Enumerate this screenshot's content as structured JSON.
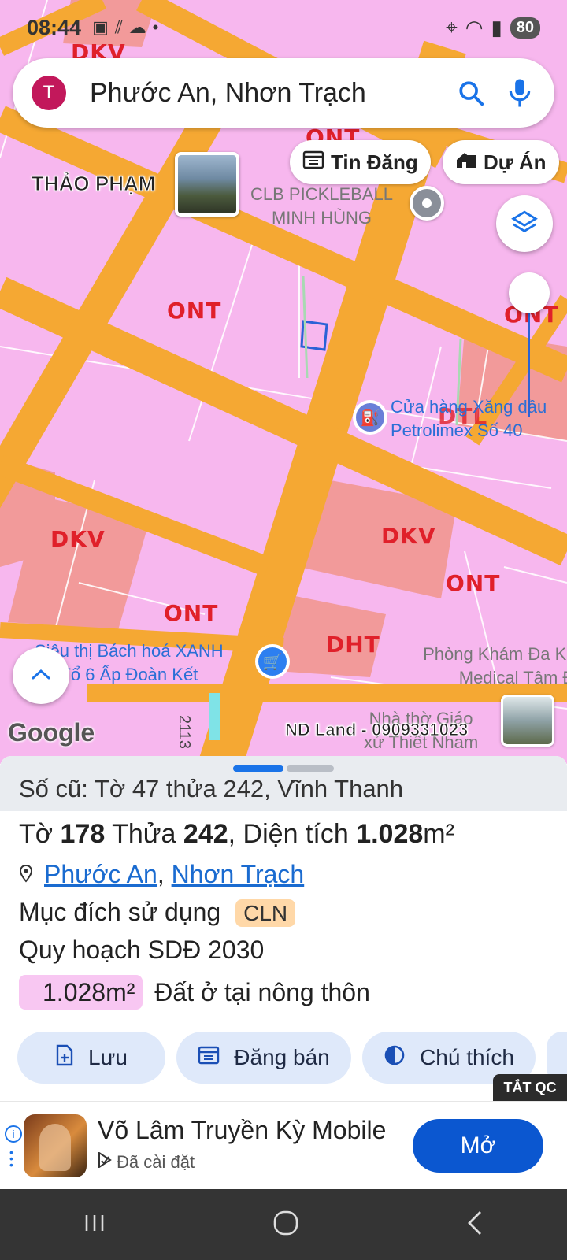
{
  "status_bar": {
    "time": "08:44",
    "battery": "80"
  },
  "search": {
    "avatar_letter": "T",
    "query": "Phước An, Nhơn Trạch"
  },
  "chips": {
    "listings": "Tin Đăng",
    "projects": "Dự Án"
  },
  "map": {
    "zones": [
      "DKV",
      "ONT",
      "ONT",
      "ONT",
      "DTL",
      "DKV",
      "DKV",
      "ONT",
      "ONT",
      "DHT"
    ],
    "user_label": "THẢO PHẠM",
    "pois": {
      "pickleball": [
        "CLB PICKLEBALL",
        "MINH HÙNG"
      ],
      "gas_station": [
        "Cửa hàng Xăng dầu",
        "Petrolimex Số 40"
      ],
      "supermarket": [
        "Siêu thị Bách hoá XANH",
        "Tổ 6 Ấp Đoàn Kết"
      ],
      "clinic": [
        "Phòng Khám Đa Khoa",
        "Medical Tâm Đức"
      ],
      "church": [
        "Nhà thờ Giáo",
        "xứ Thiết Nham"
      ]
    },
    "road_number": "2113",
    "watermark": "ND Land - 0909331023",
    "google": "Google"
  },
  "parcel": {
    "old_info": "Số cũ: Tờ 47 thửa 242, Vĩnh Thanh",
    "sheet_label": "Tờ",
    "sheet_no": "178",
    "plot_label": "Thửa",
    "plot_no": "242",
    "area_label": ", Diện tích",
    "area_value": "1.028",
    "area_unit": "m²",
    "ward": "Phước An",
    "district": "Nhơn Trạch",
    "land_use_label": "Mục đích sử dụng",
    "land_use_code": "CLN",
    "planning_label": "Quy hoạch SDĐ 2030",
    "planning_area": "1.028m²",
    "planning_type": "Đất ở tại nông thôn"
  },
  "actions": {
    "save": "Lưu",
    "post": "Đăng bán",
    "legend": "Chú thích"
  },
  "ad": {
    "tag": "TẮT QC",
    "title": "Võ Lâm Truyền Kỳ Mobile",
    "subtitle": "Đã cài đặt",
    "cta": "Mở"
  },
  "colors": {
    "map_land": "#f7b7ee",
    "road": "#f5a833",
    "zone_pink": "#f7a1a1",
    "accent_blue": "#0b57d0"
  }
}
